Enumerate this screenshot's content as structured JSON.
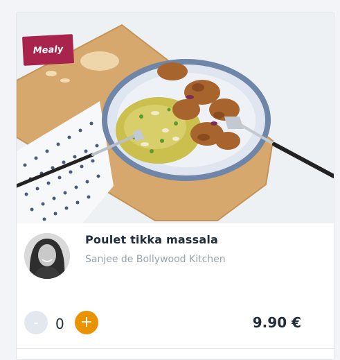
{
  "card": {
    "badge_label": "Mealy",
    "dish_name": "Poulet tikka massala",
    "chef": "Sanjee de Bollywood Kitchen",
    "quantity": "0",
    "minus_label": "-",
    "plus_label": "+",
    "price": "9.90 €"
  },
  "colors": {
    "badge": "#a8244c",
    "plus_button": "#e99300",
    "minus_button": "#e3e8ef",
    "text_dark": "#1f2d3d",
    "text_muted": "#9aa3ad"
  },
  "icons": [
    "minus-icon",
    "plus-icon"
  ]
}
